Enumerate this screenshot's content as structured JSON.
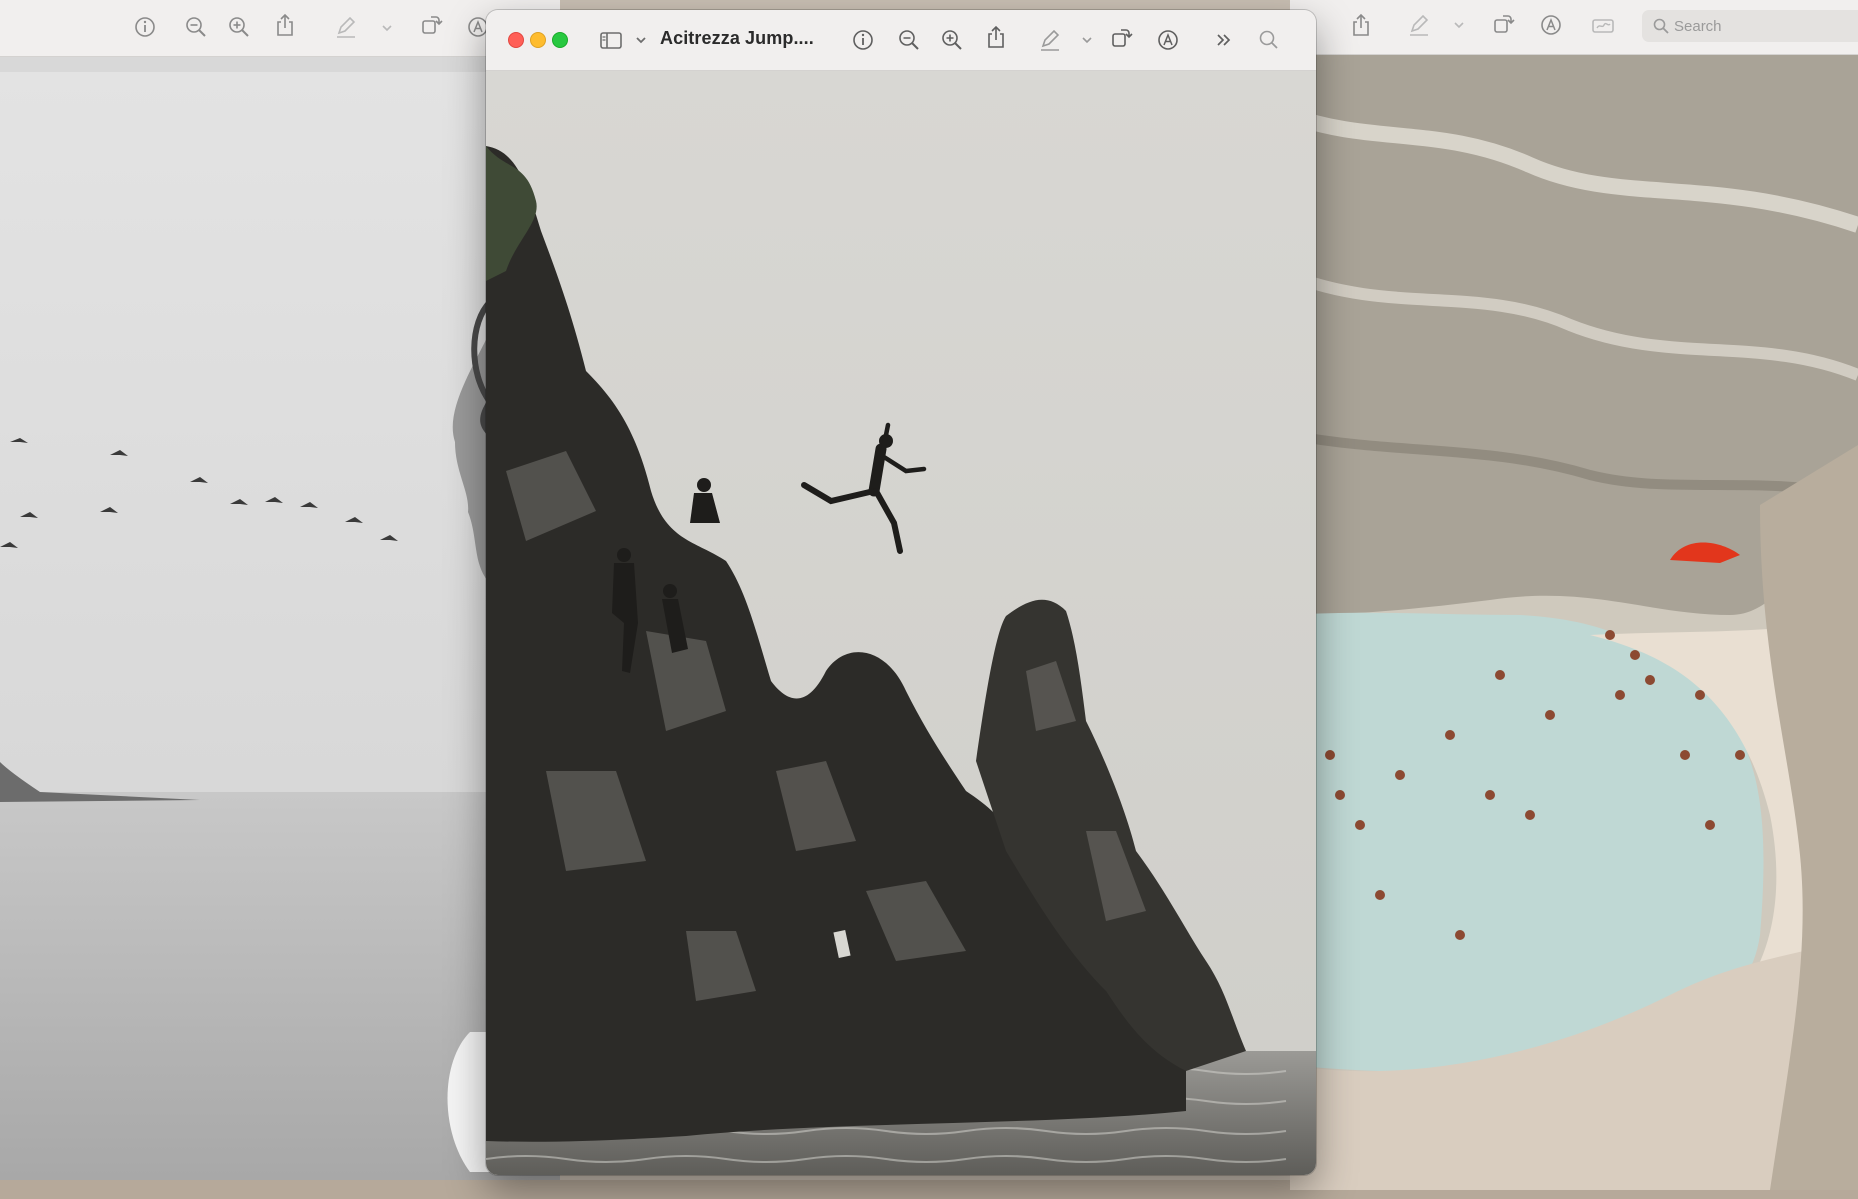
{
  "front_window": {
    "title": "Acitrezza Jump....",
    "toolbar_icons": [
      "sidebar-icon",
      "chevron-down-icon",
      "info-icon",
      "zoom-out-icon",
      "zoom-in-icon",
      "share-icon",
      "markup-pen-icon",
      "chevron-down-icon",
      "rotate-icon",
      "annotate-icon",
      "more-icon",
      "search-icon"
    ],
    "photo": "black-and-white cliff diving photo"
  },
  "left_window": {
    "toolbar_icons": [
      "info-icon",
      "zoom-out-icon",
      "zoom-in-icon",
      "share-icon",
      "markup-pen-icon",
      "chevron-down-icon",
      "rotate-icon",
      "annotate-icon"
    ],
    "photo": "black-and-white portrait with birds over sea"
  },
  "right_window": {
    "search": {
      "placeholder": "Search"
    },
    "toolbar_icons": [
      "share-icon",
      "markup-pen-icon",
      "chevron-down-icon",
      "rotate-icon",
      "annotate-icon",
      "signature-icon"
    ],
    "photo": "aerial beach with swimmers and red umbrella"
  },
  "colors": {
    "traffic_red": "#ff5f57",
    "traffic_yellow": "#febc2e",
    "traffic_green": "#28c840",
    "toolbar_bg": "#f1efee"
  }
}
